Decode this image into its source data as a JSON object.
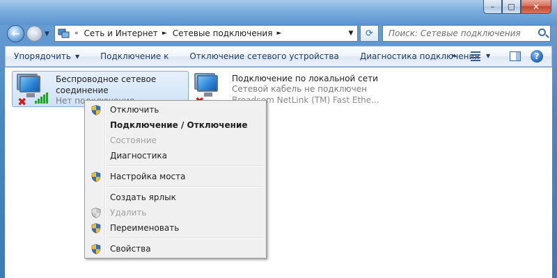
{
  "window": {
    "minimize_glyph": "–",
    "maximize_glyph": "□",
    "close_glyph": "✕"
  },
  "nav": {
    "back_glyph": "←",
    "forward_glyph": "→",
    "breadcrumb": [
      "Сеть и Интернет",
      "Сетевые подключения"
    ],
    "refresh_glyph": "⟳",
    "search_placeholder": "Поиск: Сетевые подключения"
  },
  "toolbar": {
    "organize": "Упорядочить",
    "connect_to": "Подключение к",
    "disable_device": "Отключение сетевого устройства",
    "diagnose": "Диагностика подключения",
    "more": "»",
    "help": "?"
  },
  "connections": [
    {
      "name_line1": "Беспроводное сетевое",
      "name_line2": "соединение",
      "status": "Нет подключения",
      "icon": "wireless-adapter-icon"
    },
    {
      "name": "Подключение по локальной сети",
      "status": "Сетевой кабель не подключен",
      "device": "Broadcom NetLink (TM) Fast Ethe...",
      "icon": "lan-adapter-icon"
    }
  ],
  "context_menu": {
    "groups": [
      [
        {
          "label": "Отключить",
          "shield": true,
          "bold": false,
          "disabled": false
        },
        {
          "label": "Подключение / Отключение",
          "shield": false,
          "bold": true,
          "disabled": false
        },
        {
          "label": "Состояние",
          "shield": false,
          "bold": false,
          "disabled": true
        },
        {
          "label": "Диагностика",
          "shield": false,
          "bold": false,
          "disabled": false
        }
      ],
      [
        {
          "label": "Настройка моста",
          "shield": true,
          "bold": false,
          "disabled": false
        }
      ],
      [
        {
          "label": "Создать ярлык",
          "shield": false,
          "bold": false,
          "disabled": false
        },
        {
          "label": "Удалить",
          "shield": true,
          "bold": false,
          "disabled": true
        },
        {
          "label": "Переименовать",
          "shield": true,
          "bold": false,
          "disabled": false
        }
      ],
      [
        {
          "label": "Свойства",
          "shield": true,
          "bold": false,
          "disabled": false
        }
      ]
    ]
  },
  "colors": {
    "shield_blue": "#2f6fc6",
    "shield_yellow": "#f2c12e",
    "selection_border": "#84acdd"
  }
}
